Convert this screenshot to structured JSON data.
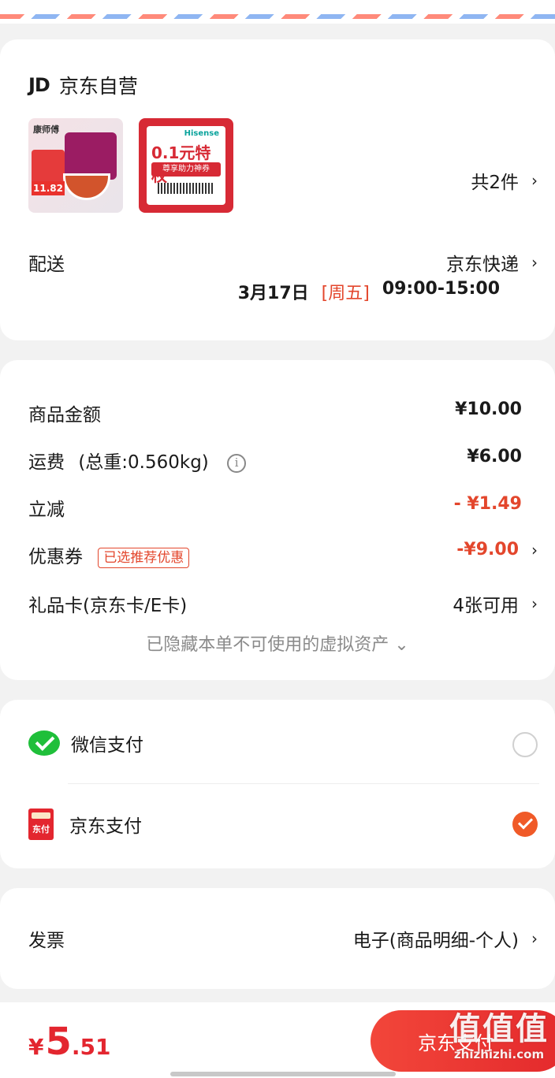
{
  "shop": {
    "logo": "JD",
    "name": "京东自营"
  },
  "products": {
    "item_a": {
      "brand_text": "康师傅",
      "price_text": "11.82"
    },
    "item_b": {
      "brand_text": "Hisense",
      "headline": "0.1元特权",
      "subline": "尊享助力神券"
    },
    "count_label": "共2件"
  },
  "delivery": {
    "label": "配送",
    "method": "京东快递",
    "date": "3月17日",
    "weekday": "[周五]",
    "time_range": "09:00-15:00"
  },
  "summary": {
    "goods_label": "商品金额",
    "goods_value": "¥10.00",
    "shipping_label": "运费",
    "shipping_weight": "(总重:0.560kg)",
    "shipping_value": "¥6.00",
    "discount_label": "立减",
    "discount_value": "- ¥1.49",
    "coupon_label": "优惠券",
    "coupon_badge": "已选推荐优惠",
    "coupon_value": "-¥9.00",
    "giftcard_label": "礼品卡(京东卡/E卡)",
    "giftcard_value": "4张可用",
    "hidden_assets": "已隐藏本单不可使用的虚拟资产 ⌄"
  },
  "payment": {
    "wechat_label": "微信支付",
    "jdpay_label": "京东支付",
    "jdpay_icon_text": "东付",
    "selected": "京东支付"
  },
  "invoice": {
    "label": "发票",
    "value": "电子(商品明细-个人)"
  },
  "footer": {
    "currency": "¥",
    "total_int": "5",
    "total_dec": ".51",
    "pay_button": "京东支付"
  },
  "watermark": {
    "big": "值值值",
    "small": "zhizhizhi.com"
  },
  "colors": {
    "accent_red": "#e3262f",
    "accent_orange": "#f05a28",
    "wechat_green": "#1fbf3a"
  }
}
